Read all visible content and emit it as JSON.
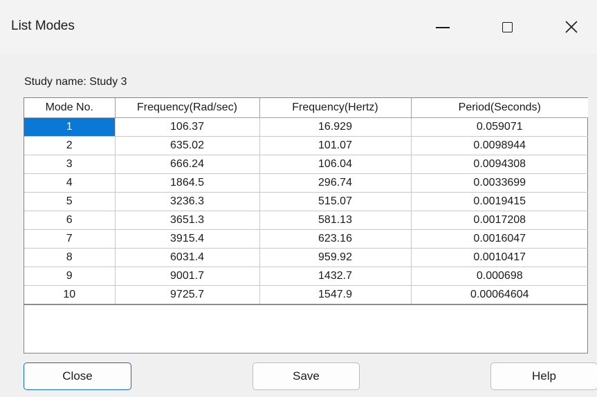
{
  "window": {
    "title": "List Modes",
    "controls": {
      "minimize": "minimize",
      "maximize": "maximize",
      "close": "close"
    }
  },
  "study": {
    "label": "Study name: Study 3"
  },
  "table": {
    "headers": [
      "Mode No.",
      "Frequency(Rad/sec)",
      "Frequency(Hertz)",
      "Period(Seconds)"
    ],
    "selected_row": 0,
    "rows": [
      [
        "1",
        "106.37",
        "16.929",
        "0.059071"
      ],
      [
        "2",
        "635.02",
        "101.07",
        "0.0098944"
      ],
      [
        "3",
        "666.24",
        "106.04",
        "0.0094308"
      ],
      [
        "4",
        "1864.5",
        "296.74",
        "0.0033699"
      ],
      [
        "5",
        "3236.3",
        "515.07",
        "0.0019415"
      ],
      [
        "6",
        "3651.3",
        "581.13",
        "0.0017208"
      ],
      [
        "7",
        "3915.4",
        "623.16",
        "0.0016047"
      ],
      [
        "8",
        "6031.4",
        "959.92",
        "0.0010417"
      ],
      [
        "9",
        "9001.7",
        "1432.7",
        "0.000698"
      ],
      [
        "10",
        "9725.7",
        "1547.9",
        "0.00064604"
      ]
    ]
  },
  "buttons": {
    "close": "Close",
    "save": "Save",
    "help": "Help"
  },
  "colors": {
    "selection": "#0a78d7",
    "background": "#f0f0f0",
    "focus_border": "#0b6ec5"
  }
}
